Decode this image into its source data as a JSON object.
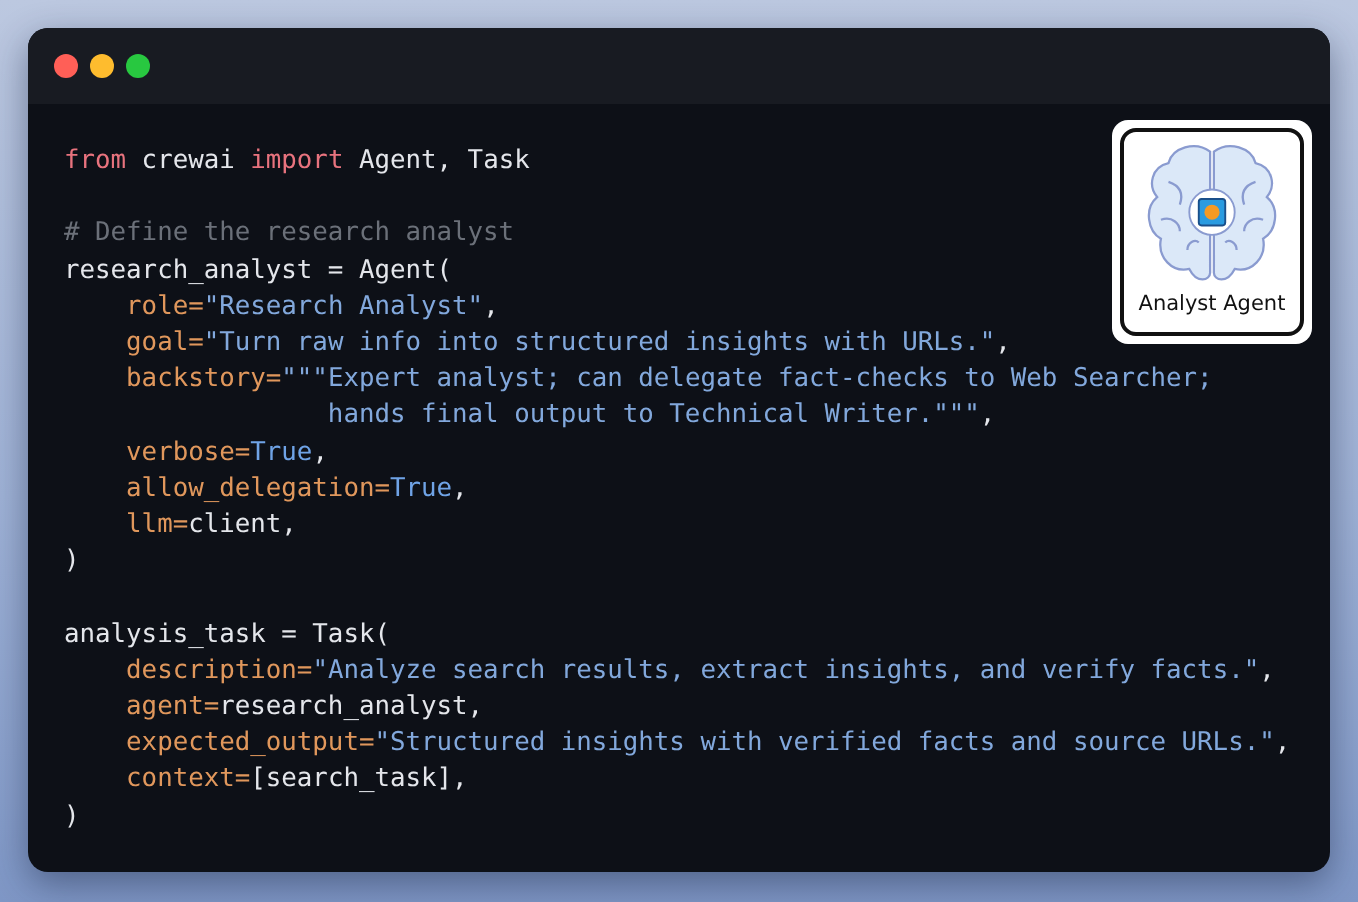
{
  "window": {
    "controls": [
      {
        "kind": "close"
      },
      {
        "kind": "minimize"
      },
      {
        "kind": "zoom"
      }
    ]
  },
  "code_blocks": [
    {
      "lines": [
        {
          "tokens": [
            {
              "kind": "keyword",
              "text": "from"
            },
            {
              "kind": "plain",
              "text": " crewai "
            },
            {
              "kind": "keyword",
              "text": "import"
            },
            {
              "kind": "plain",
              "text": " Agent, Task"
            }
          ]
        }
      ]
    },
    {
      "lines": [
        {
          "tokens": [
            {
              "kind": "comment",
              "text": "# Define the research analyst"
            }
          ]
        },
        {
          "tokens": [
            {
              "kind": "plain",
              "text": "research_analyst = Agent("
            }
          ]
        },
        {
          "tokens": [
            {
              "kind": "param",
              "text": "    role="
            },
            {
              "kind": "string",
              "text": "\"Research Analyst\""
            },
            {
              "kind": "plain",
              "text": ","
            }
          ]
        },
        {
          "tokens": [
            {
              "kind": "param",
              "text": "    goal="
            },
            {
              "kind": "string",
              "text": "\"Turn raw info into structured insights with URLs.\""
            },
            {
              "kind": "plain",
              "text": ","
            }
          ]
        },
        {
          "tokens": [
            {
              "kind": "param",
              "text": "    backstory="
            },
            {
              "kind": "string",
              "text": "\"\"\"Expert analyst; can delegate fact-checks to Web Searcher;"
            }
          ]
        },
        {
          "tokens": [
            {
              "kind": "string",
              "text": "                 hands final output to Technical Writer.\"\"\""
            },
            {
              "kind": "plain",
              "text": ","
            }
          ]
        },
        {
          "tokens": [
            {
              "kind": "param",
              "text": "    verbose="
            },
            {
              "kind": "bool",
              "text": "True"
            },
            {
              "kind": "plain",
              "text": ","
            }
          ]
        },
        {
          "tokens": [
            {
              "kind": "param",
              "text": "    allow_delegation="
            },
            {
              "kind": "bool",
              "text": "True"
            },
            {
              "kind": "plain",
              "text": ","
            }
          ]
        },
        {
          "tokens": [
            {
              "kind": "param",
              "text": "    llm="
            },
            {
              "kind": "plain",
              "text": "client,"
            }
          ]
        },
        {
          "tokens": [
            {
              "kind": "plain",
              "text": ")"
            }
          ]
        }
      ]
    },
    {
      "lines": [
        {
          "tokens": [
            {
              "kind": "plain",
              "text": "analysis_task = Task("
            }
          ]
        },
        {
          "tokens": [
            {
              "kind": "param",
              "text": "    description="
            },
            {
              "kind": "string",
              "text": "\"Analyze search results, extract insights, and verify facts.\""
            },
            {
              "kind": "plain",
              "text": ","
            }
          ]
        },
        {
          "tokens": [
            {
              "kind": "param",
              "text": "    agent="
            },
            {
              "kind": "plain",
              "text": "research_analyst,"
            }
          ]
        },
        {
          "tokens": [
            {
              "kind": "param",
              "text": "    expected_output="
            },
            {
              "kind": "string",
              "text": "\"Structured insights with verified facts and source URLs.\""
            },
            {
              "kind": "plain",
              "text": ","
            }
          ]
        },
        {
          "tokens": [
            {
              "kind": "param",
              "text": "    context="
            },
            {
              "kind": "plain",
              "text": "[search_task],"
            }
          ]
        },
        {
          "tokens": [
            {
              "kind": "plain",
              "text": ")"
            }
          ]
        }
      ]
    }
  ],
  "badge": {
    "label": "Analyst Agent"
  }
}
